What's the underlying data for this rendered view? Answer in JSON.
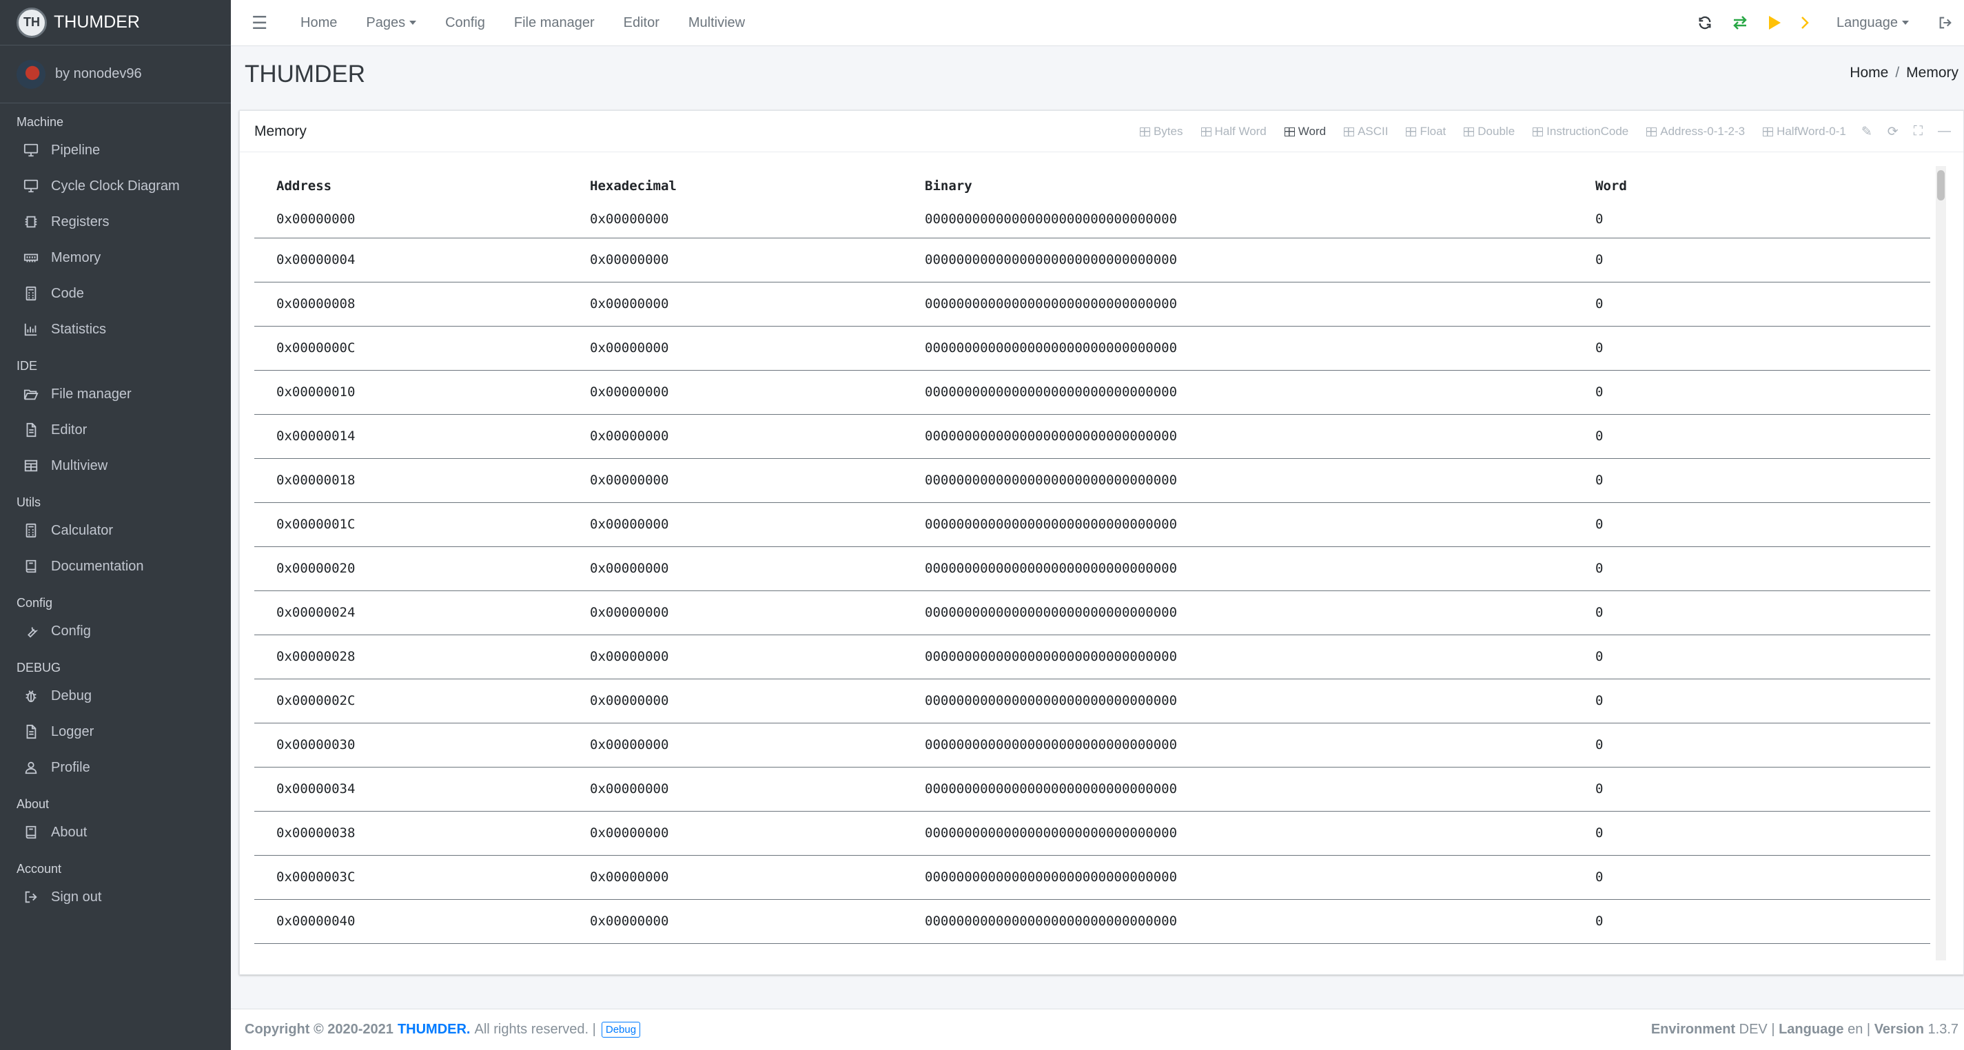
{
  "brand": {
    "name": "THUMDER",
    "logo_glyph": "TH"
  },
  "user": {
    "name": "by nonodev96"
  },
  "sidebar": {
    "sections": [
      {
        "header": "Machine",
        "items": [
          {
            "label": "Pipeline",
            "icon": "monitor-icon"
          },
          {
            "label": "Cycle Clock Diagram",
            "icon": "monitor-icon"
          },
          {
            "label": "Registers",
            "icon": "chip-icon"
          },
          {
            "label": "Memory",
            "icon": "memory-icon"
          },
          {
            "label": "Code",
            "icon": "calculator-icon"
          },
          {
            "label": "Statistics",
            "icon": "chart-icon"
          }
        ]
      },
      {
        "header": "IDE",
        "items": [
          {
            "label": "File manager",
            "icon": "folder-open-icon"
          },
          {
            "label": "Editor",
            "icon": "file-icon"
          },
          {
            "label": "Multiview",
            "icon": "table-icon"
          }
        ]
      },
      {
        "header": "Utils",
        "items": [
          {
            "label": "Calculator",
            "icon": "calculator-icon"
          },
          {
            "label": "Documentation",
            "icon": "book-icon"
          }
        ]
      },
      {
        "header": "Config",
        "items": [
          {
            "label": "Config",
            "icon": "wrench-icon"
          }
        ]
      },
      {
        "header": "DEBUG",
        "items": [
          {
            "label": "Debug",
            "icon": "bug-icon"
          },
          {
            "label": "Logger",
            "icon": "file-icon"
          },
          {
            "label": "Profile",
            "icon": "user-icon"
          }
        ]
      },
      {
        "header": "About",
        "items": [
          {
            "label": "About",
            "icon": "book-icon"
          }
        ]
      },
      {
        "header": "Account",
        "items": [
          {
            "label": "Sign out",
            "icon": "sign-out-icon"
          }
        ]
      }
    ]
  },
  "topbar": {
    "links": [
      "Home",
      "Pages",
      "Config",
      "File manager",
      "Editor",
      "Multiview"
    ],
    "language_label": "Language",
    "icons": {
      "reload": "sync-icon",
      "step": "exchange-icon",
      "run": "play-icon",
      "next": "chevron-right-icon",
      "logout": "sign-out-icon"
    },
    "colors": {
      "reload": "#343a40",
      "step": "#28a745",
      "run": "#ffc107",
      "next": "#ffc107"
    }
  },
  "page": {
    "title": "THUMDER"
  },
  "breadcrumb": {
    "home": "Home",
    "current": "Memory"
  },
  "card": {
    "title": "Memory",
    "view_modes": [
      "Bytes",
      "Half Word",
      "Word",
      "ASCII",
      "Float",
      "Double",
      "InstructionCode",
      "Address-0-1-2-3",
      "HalfWord-0-1"
    ],
    "active_mode": "Word"
  },
  "table": {
    "columns": [
      "Address",
      "Hexadecimal",
      "Binary",
      "Word"
    ],
    "rows": [
      {
        "address": "0x00000000",
        "hex": "0x00000000",
        "binary": "00000000000000000000000000000000",
        "word": "0"
      },
      {
        "address": "0x00000004",
        "hex": "0x00000000",
        "binary": "00000000000000000000000000000000",
        "word": "0"
      },
      {
        "address": "0x00000008",
        "hex": "0x00000000",
        "binary": "00000000000000000000000000000000",
        "word": "0"
      },
      {
        "address": "0x0000000C",
        "hex": "0x00000000",
        "binary": "00000000000000000000000000000000",
        "word": "0"
      },
      {
        "address": "0x00000010",
        "hex": "0x00000000",
        "binary": "00000000000000000000000000000000",
        "word": "0"
      },
      {
        "address": "0x00000014",
        "hex": "0x00000000",
        "binary": "00000000000000000000000000000000",
        "word": "0"
      },
      {
        "address": "0x00000018",
        "hex": "0x00000000",
        "binary": "00000000000000000000000000000000",
        "word": "0"
      },
      {
        "address": "0x0000001C",
        "hex": "0x00000000",
        "binary": "00000000000000000000000000000000",
        "word": "0"
      },
      {
        "address": "0x00000020",
        "hex": "0x00000000",
        "binary": "00000000000000000000000000000000",
        "word": "0"
      },
      {
        "address": "0x00000024",
        "hex": "0x00000000",
        "binary": "00000000000000000000000000000000",
        "word": "0"
      },
      {
        "address": "0x00000028",
        "hex": "0x00000000",
        "binary": "00000000000000000000000000000000",
        "word": "0"
      },
      {
        "address": "0x0000002C",
        "hex": "0x00000000",
        "binary": "00000000000000000000000000000000",
        "word": "0"
      },
      {
        "address": "0x00000030",
        "hex": "0x00000000",
        "binary": "00000000000000000000000000000000",
        "word": "0"
      },
      {
        "address": "0x00000034",
        "hex": "0x00000000",
        "binary": "00000000000000000000000000000000",
        "word": "0"
      },
      {
        "address": "0x00000038",
        "hex": "0x00000000",
        "binary": "00000000000000000000000000000000",
        "word": "0"
      },
      {
        "address": "0x0000003C",
        "hex": "0x00000000",
        "binary": "00000000000000000000000000000000",
        "word": "0"
      },
      {
        "address": "0x00000040",
        "hex": "0x00000000",
        "binary": "00000000000000000000000000000000",
        "word": "0"
      }
    ]
  },
  "footer": {
    "copyright": "Copyright © 2020-2021",
    "brand_link": "THUMDER.",
    "rights": "All rights reserved. |",
    "debug_badge": "Debug",
    "env_label": "Environment",
    "env_value": "DEV",
    "lang_label": "Language",
    "lang_value": "en",
    "version_label": "Version",
    "version_value": "1.3.7",
    "sep": "|"
  }
}
